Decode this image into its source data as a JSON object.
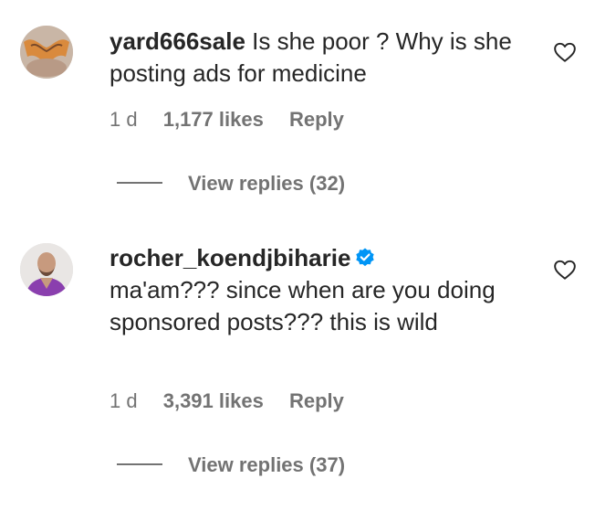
{
  "comments": [
    {
      "username": "yard666sale",
      "text": "Is she poor ? Why is she posting ads for medicine",
      "time": "1 d",
      "likes": "1,177 likes",
      "reply_label": "Reply",
      "view_replies": "View replies (32)",
      "verified": false
    },
    {
      "username": "rocher_koendjbiharie",
      "text": "ma'am??? since when are you doing sponsored posts??? this is wild",
      "time": "1 d",
      "likes": "3,391 likes",
      "reply_label": "Reply",
      "view_replies": "View replies (37)",
      "verified": true
    }
  ],
  "icons": {
    "like": "heart-outline-icon",
    "verified": "verified-badge-icon"
  },
  "colors": {
    "text": "#262626",
    "secondary": "#737373",
    "verified": "#0095f6"
  }
}
